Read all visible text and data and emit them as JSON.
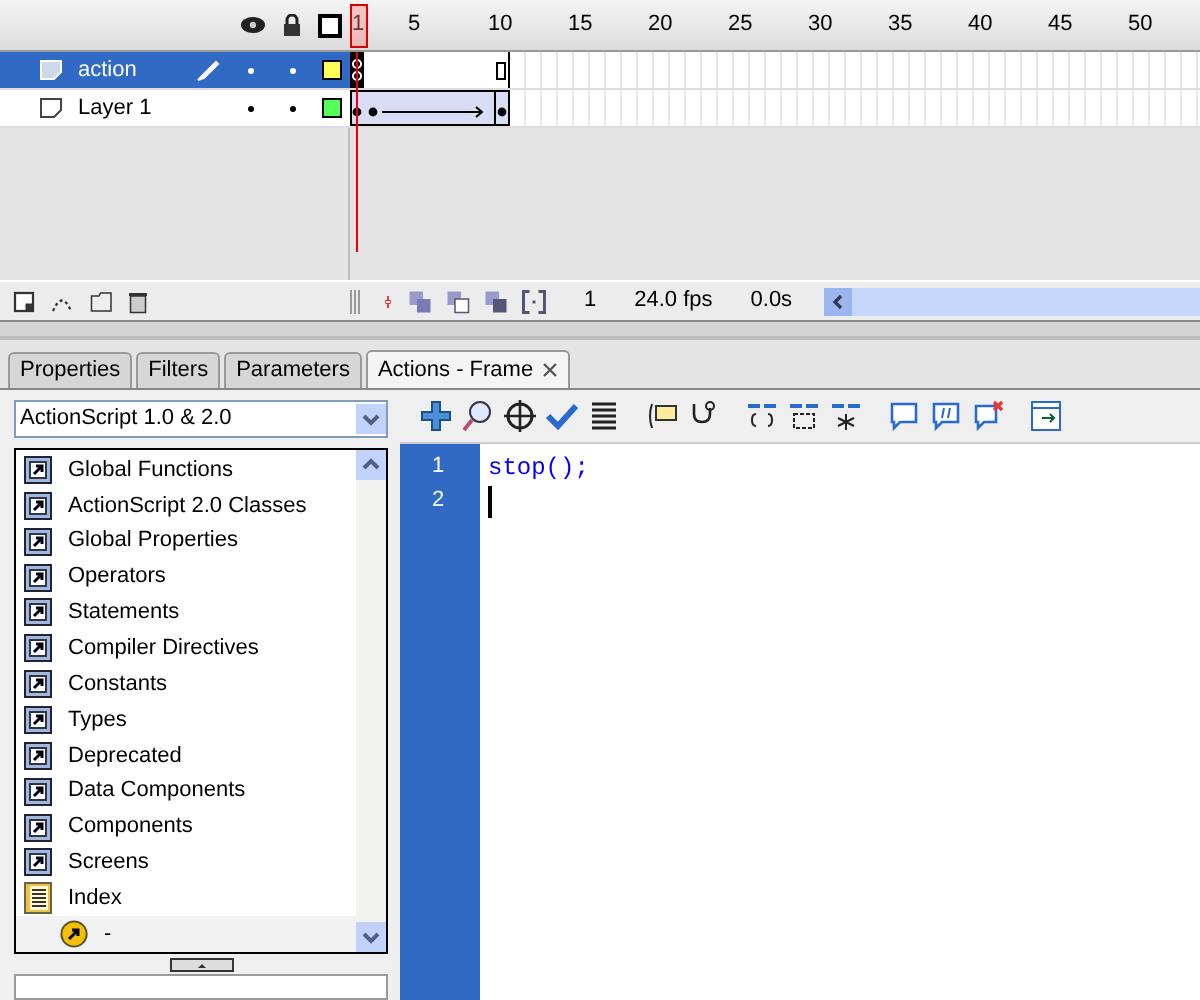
{
  "timeline": {
    "ruler": [
      "1",
      "5",
      "10",
      "15",
      "20",
      "25",
      "30",
      "35",
      "40",
      "45",
      "50"
    ],
    "layers": [
      {
        "name": "action",
        "selected": true,
        "editing": true,
        "color": "#ffff55",
        "kind": "actions"
      },
      {
        "name": "Layer 1",
        "selected": false,
        "editing": false,
        "color": "#55ff55",
        "kind": "tween"
      }
    ],
    "status": {
      "frame": "1",
      "fps": "24.0 fps",
      "time": "0.0s"
    }
  },
  "tabs": [
    {
      "label": "Properties",
      "selected": false
    },
    {
      "label": "Filters",
      "selected": false
    },
    {
      "label": "Parameters",
      "selected": false
    },
    {
      "label": "Actions - Frame",
      "selected": true,
      "closable": true
    }
  ],
  "actions": {
    "version": "ActionScript 1.0 & 2.0",
    "toolbox": [
      {
        "label": "Global Functions",
        "kind": "book"
      },
      {
        "label": "ActionScript 2.0 Classes",
        "kind": "book"
      },
      {
        "label": "Global Properties",
        "kind": "book"
      },
      {
        "label": "Operators",
        "kind": "book"
      },
      {
        "label": "Statements",
        "kind": "book"
      },
      {
        "label": "Compiler Directives",
        "kind": "book"
      },
      {
        "label": "Constants",
        "kind": "book"
      },
      {
        "label": "Types",
        "kind": "book"
      },
      {
        "label": "Deprecated",
        "kind": "book"
      },
      {
        "label": "Data Components",
        "kind": "book"
      },
      {
        "label": "Components",
        "kind": "book"
      },
      {
        "label": "Screens",
        "kind": "book"
      },
      {
        "label": "Index",
        "kind": "index",
        "children": [
          {
            "label": "-",
            "kind": "entry"
          }
        ]
      }
    ],
    "code": [
      {
        "number": "1",
        "code": "stop();"
      },
      {
        "number": "2",
        "cursor": true
      }
    ]
  }
}
